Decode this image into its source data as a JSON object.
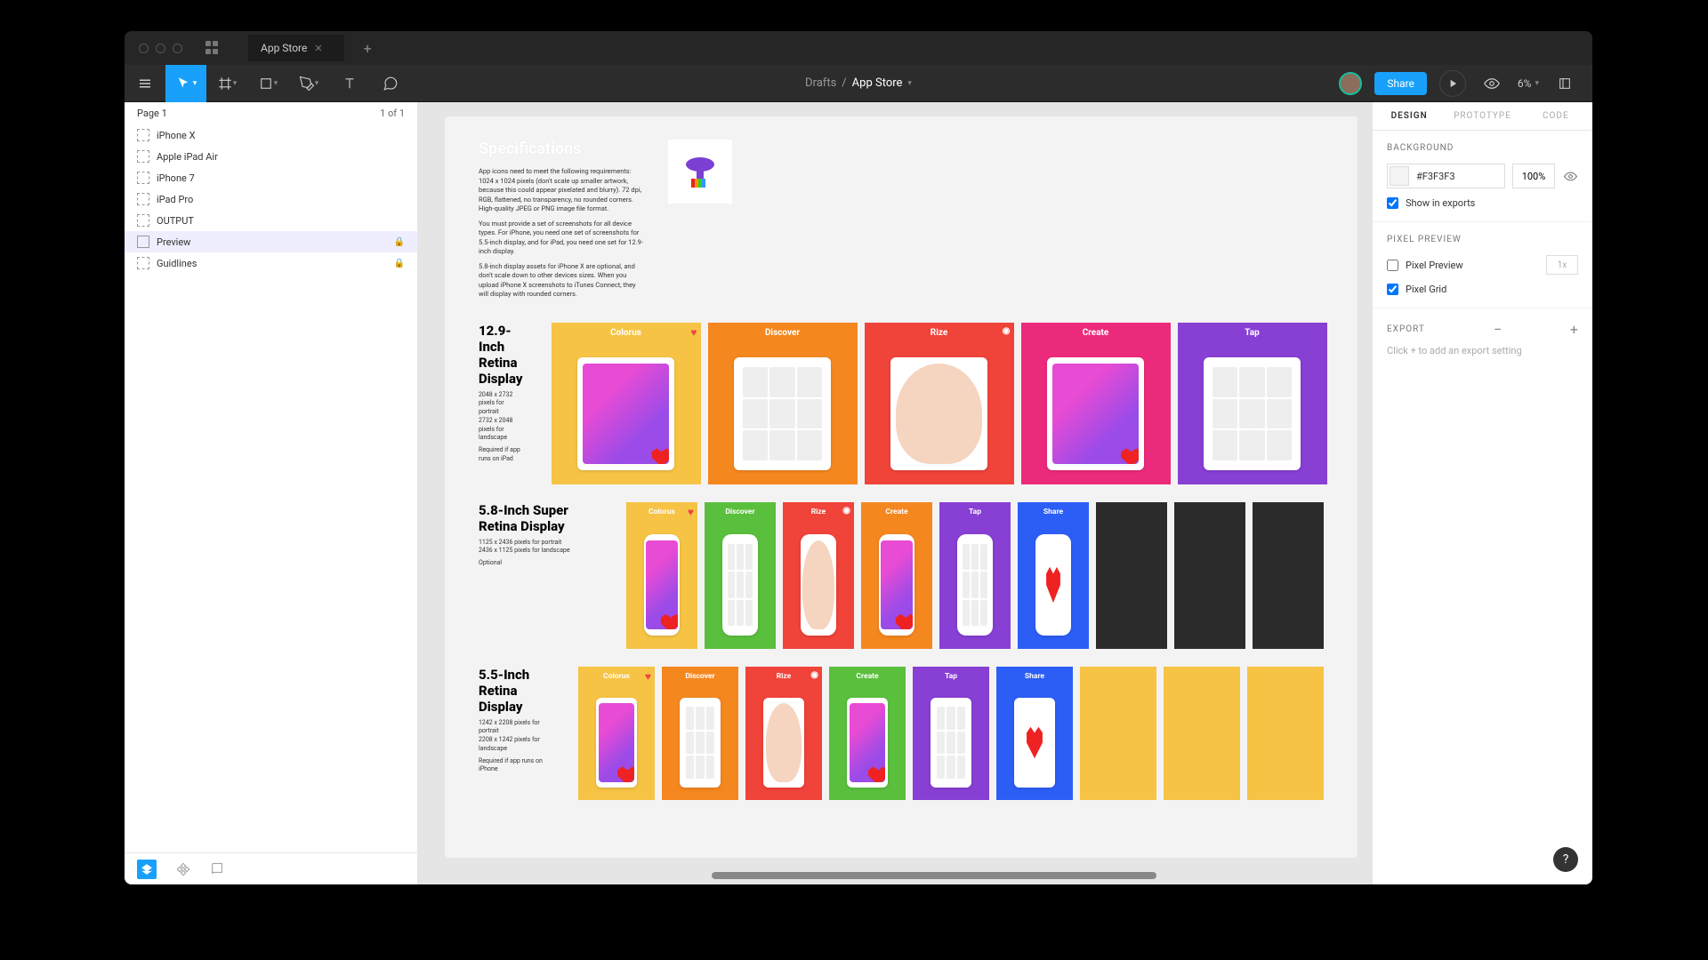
{
  "titlebar": {
    "tab": "App Store"
  },
  "breadcrumb": {
    "root": "Drafts",
    "current": "App Store"
  },
  "toolbar": {
    "share": "Share",
    "zoom": "6%"
  },
  "pages": {
    "label": "Page 1",
    "count": "1 of 1"
  },
  "layers": [
    {
      "name": "iPhone X",
      "locked": false
    },
    {
      "name": "Apple iPad Air",
      "locked": false
    },
    {
      "name": "iPhone 7",
      "locked": false
    },
    {
      "name": "iPad Pro",
      "locked": false
    },
    {
      "name": "OUTPUT",
      "locked": false
    },
    {
      "name": "Preview",
      "locked": true,
      "solid": true,
      "sel": true
    },
    {
      "name": "Guidlines",
      "locked": true
    }
  ],
  "canvas": {
    "spec_title": "Specifications",
    "spec_p1": "App icons need to meet the following requirements: 1024 x 1024 pixels (don't scale up smaller artwork, because this could appear pixelated and blurry). 72 dpi, RGB, flattened, no transparency, no rounded corners. High-quality JPEG or PNG image file format.",
    "spec_p2": "You must provide a set of screenshots for all device types. For iPhone, you need one set of screenshots for 5.5-inch display, and for iPad, you need one set for 12.9-inch display.",
    "spec_p3": "5.8-inch display assets for iPhone X are optional, and don't scale down to other devices sizes. When you upload iPhone X screenshots to iTunes Connect, they will display with rounded corners.",
    "rows": [
      {
        "title": "12.9-Inch Retina Display",
        "meta1": "2048 x 2732 pixels for portrait",
        "meta2": "2732 x 2048 pixels for landscape",
        "req": "Required if app runs on iPad",
        "shots": [
          {
            "t": "Colorus",
            "c": "yellow"
          },
          {
            "t": "Discover",
            "c": "orange"
          },
          {
            "t": "Rize",
            "c": "red"
          },
          {
            "t": "Create",
            "c": "pink"
          },
          {
            "t": "Tap",
            "c": "purple"
          }
        ]
      },
      {
        "title": "5.8-Inch Super Retina Display",
        "meta1": "1125 x 2436 pixels for portrait",
        "meta2": "2436 x 1125 pixels for landscape",
        "req": "Optional",
        "shots": [
          {
            "t": "Colorus",
            "c": "yellow"
          },
          {
            "t": "Discover",
            "c": "green"
          },
          {
            "t": "Rize",
            "c": "red"
          },
          {
            "t": "Create",
            "c": "orange"
          },
          {
            "t": "Tap",
            "c": "purple"
          },
          {
            "t": "Share",
            "c": "blue"
          }
        ],
        "empties": 3
      },
      {
        "title": "5.5-Inch Retina Display",
        "meta1": "1242 x 2208 pixels for portrait",
        "meta2": "2208 x 1242 pixels for landscape",
        "req": "Required if app runs on iPhone",
        "shots": [
          {
            "t": "Colorus",
            "c": "yellow"
          },
          {
            "t": "Discover",
            "c": "orange"
          },
          {
            "t": "Rize",
            "c": "red"
          },
          {
            "t": "Create",
            "c": "green"
          },
          {
            "t": "Tap",
            "c": "purple"
          },
          {
            "t": "Share",
            "c": "blue"
          }
        ],
        "empties": 3,
        "empty_color": "yellow"
      }
    ]
  },
  "right": {
    "tabs": [
      "DESIGN",
      "PROTOTYPE",
      "CODE"
    ],
    "background": {
      "label": "BACKGROUND",
      "hex": "#F3F3F3",
      "opacity": "100%",
      "show_exports": "Show in exports"
    },
    "pixel": {
      "label": "PIXEL PREVIEW",
      "preview": "Pixel Preview",
      "scale": "1x",
      "grid": "Pixel Grid"
    },
    "export": {
      "label": "EXPORT",
      "hint": "Click + to add an export setting"
    }
  }
}
